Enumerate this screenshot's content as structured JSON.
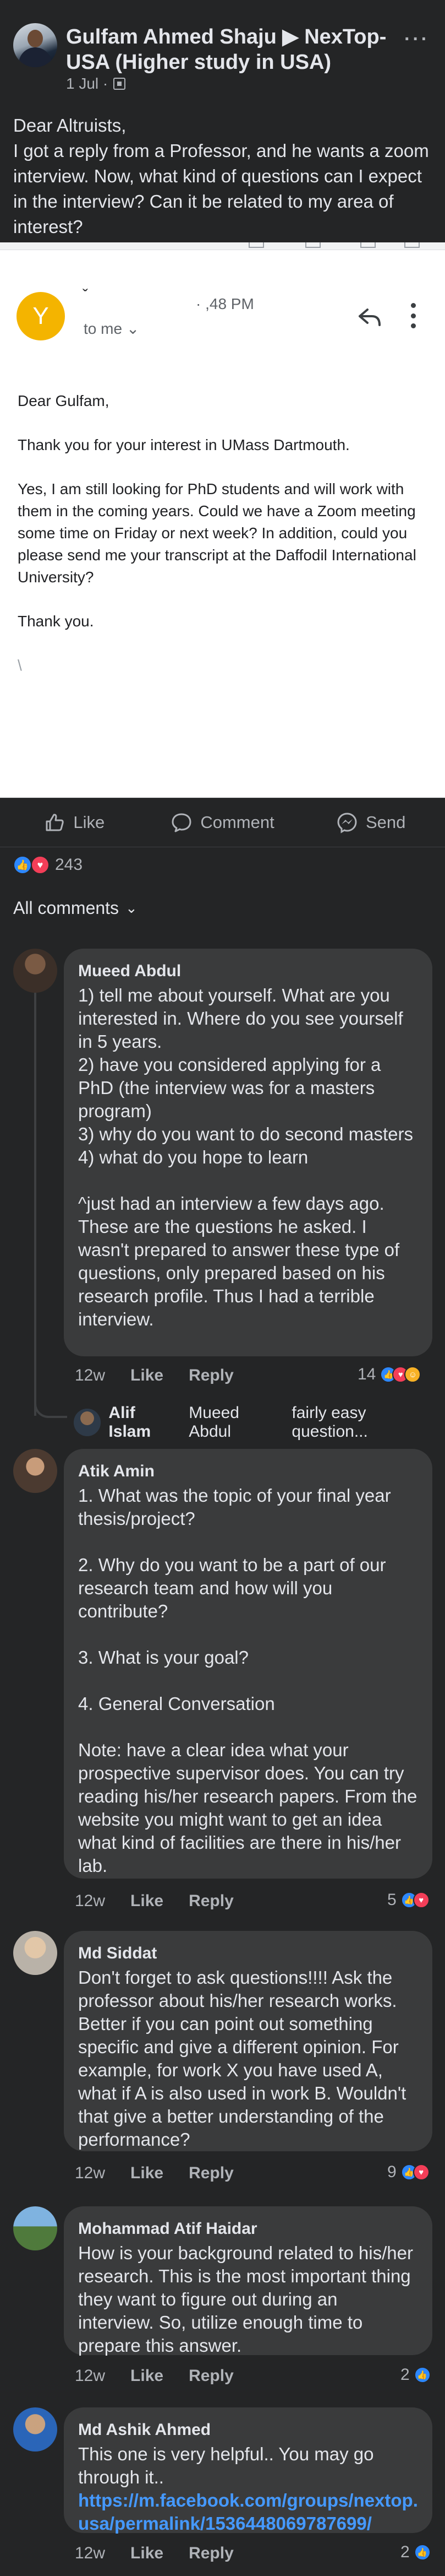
{
  "post": {
    "author": "Gulfam Ahmed Shaju ▶ NexTop-USA (Higher study in USA)",
    "date": "1 Jul ·",
    "more": "···",
    "text": "Dear Altruists,\nI got a reply from a Professor, and he wants a zoom interview. Now, what kind of questions can I expect in the interview? Can it be related to my area of interest?"
  },
  "email": {
    "avatar_letter": "Y",
    "sender_caret": "ˇ",
    "time": "· ,48 PM",
    "to": "to me",
    "greeting": "Dear Gulfam,",
    "para1": "Thank you for your interest in UMass Dartmouth.",
    "para2": "Yes, I am still looking for PhD students and will work with them in the coming years. Could we have a Zoom meeting some time on Friday or next week? In addition, could you please send me your transcript at the Daffodil International University?",
    "closing": "Thank you.",
    "signature": "\\"
  },
  "actions": {
    "like": "Like",
    "comment": "Comment",
    "send": "Send"
  },
  "reactions": {
    "count": "243"
  },
  "comments_filter": "All comments",
  "comments": [
    {
      "name": "Mueed Abdul",
      "text": "1) tell me about yourself. What are you interested in. Where do you see yourself in 5 years.\n2) have you considered applying for a PhD (the interview was for a masters program)\n3) why do you want to do second masters\n4) what do you hope to learn\n\n^just had an interview a few days ago. These are the questions he asked. I wasn't prepared to answer these type of questions, only prepared based on his research profile. Thus I had a terrible interview.",
      "time": "12w",
      "like": "Like",
      "reply": "Reply",
      "count": "14"
    },
    {
      "name": "Atik Amin",
      "text": "1. What was the topic of your final year thesis/project?\n\n2. Why do you want to be a part of our research team and how will you contribute?\n\n3. What is your goal?\n\n4. General Conversation\n\nNote: have a clear idea what your prospective supervisor does. You can try reading his/her research papers. From the website you might want to get an idea what kind of facilities are there in his/her lab.",
      "time": "12w",
      "like": "Like",
      "reply": "Reply",
      "count": "5"
    },
    {
      "name": "Md Siddat",
      "text": "Don't forget to ask questions!!!! Ask the professor about his/her research works. Better if you can point out something specific and give a different opinion. For example, for work X you have used A, what if A is also used in work B. Wouldn't that give a better understanding of the performance?",
      "time": "12w",
      "like": "Like",
      "reply": "Reply",
      "count": "9"
    },
    {
      "name": "Mohammad Atif Haidar",
      "text": "How is your background related to his/her research. This is the most important thing they want to figure out during an interview. So, utilize enough time to prepare this answer.",
      "time": "12w",
      "like": "Like",
      "reply": "Reply",
      "count": "2"
    },
    {
      "name": "Md Ashik Ahmed",
      "text": "This one is very helpful.. You may go through it..",
      "link": "https://m.facebook.com/groups/nextop.usa/permalink/1536448069787699/",
      "time": "12w",
      "like": "Like",
      "reply": "Reply",
      "count": "2"
    }
  ],
  "reply_preview": {
    "name": "Alif Islam",
    "mention": "Mueed Abdul",
    "text": "fairly easy question..."
  }
}
